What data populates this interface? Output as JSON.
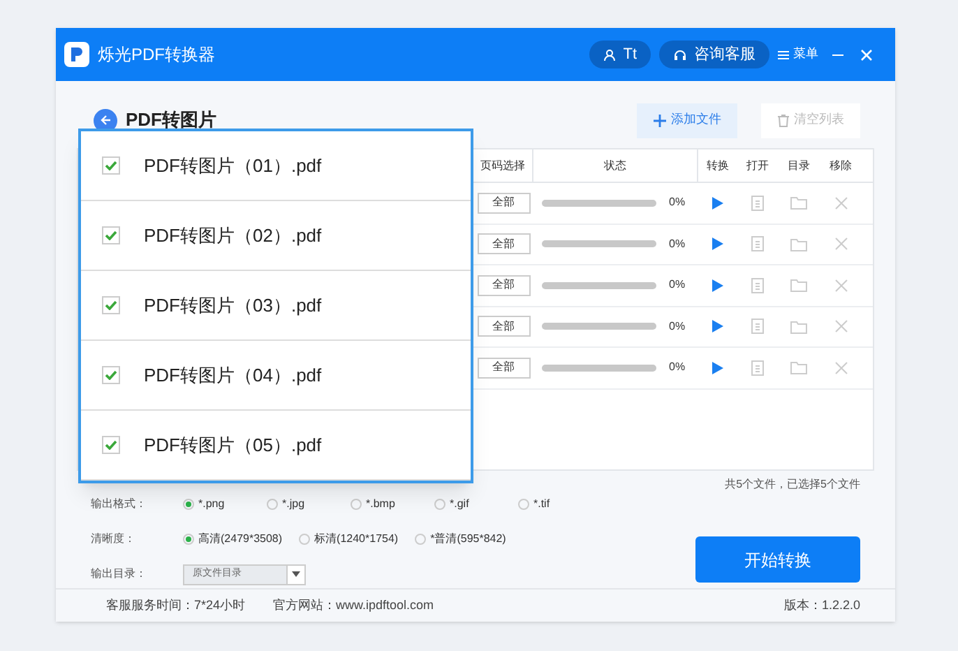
{
  "window": {
    "title": "烁光PDF转换器"
  },
  "header_buttons": {
    "user": "Tt",
    "support": "咨询客服",
    "menu": "菜单"
  },
  "page_title": "PDF转图片",
  "toolbar": {
    "add_file": "添加文件",
    "clear_list": {
      "label": "清空列表",
      "disabled": true
    }
  },
  "table": {
    "columns": [
      "页码选择",
      "状态",
      "转换",
      "打开",
      "目录",
      "移除"
    ],
    "rows": [
      {
        "pages": "全部",
        "level": 0,
        "percent": "0%"
      },
      {
        "pages": "全部",
        "level": 0,
        "percent": "0%"
      },
      {
        "pages": "全部",
        "level": 0,
        "percent": "0%"
      },
      {
        "pages": "全部",
        "level": 0,
        "percent": "0%"
      },
      {
        "pages": "全部",
        "level": 0,
        "percent": "0%"
      }
    ]
  },
  "file_popup": [
    {
      "name": "PDF转图片（01）.pdf",
      "checked": true
    },
    {
      "name": "PDF转图片（02）.pdf",
      "checked": true
    },
    {
      "name": "PDF转图片（03）.pdf",
      "checked": true
    },
    {
      "name": "PDF转图片（04）.pdf",
      "checked": true
    },
    {
      "name": "PDF转图片（05）.pdf",
      "checked": true
    }
  ],
  "summary": "共5个文件，已选择5个文件",
  "options": [
    {
      "label": "输出格式：",
      "kind": "radio",
      "choices": [
        {
          "label": "*.png",
          "selected": true
        },
        {
          "label": "*.jpg",
          "selected": false
        },
        {
          "label": "*.bmp",
          "selected": false
        },
        {
          "label": "*.gif",
          "selected": false
        },
        {
          "label": "*.tif",
          "selected": false
        }
      ]
    },
    {
      "label": "清晰度：",
      "kind": "radio",
      "choices": [
        {
          "label": "高清(2479*3508)",
          "selected": true
        },
        {
          "label": "标清(1240*1754)",
          "selected": false
        },
        {
          "label": "*普清(595*842)",
          "selected": false
        }
      ]
    },
    {
      "label": "输出目录：",
      "kind": "dropdown",
      "value": "原文件目录"
    }
  ],
  "start_button": "开始转换",
  "footer": {
    "service_hours": "客服服务时间：7*24小时",
    "website": "官方网站：www.ipdftool.com",
    "version": "版本：1.2.2.0"
  }
}
